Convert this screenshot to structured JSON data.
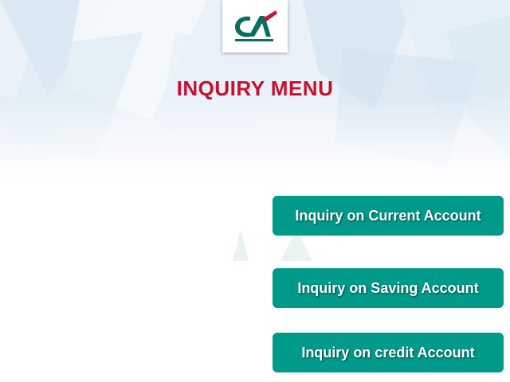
{
  "logo": {
    "icon": "credit-agricole-logo",
    "text": "CA",
    "colors": {
      "green": "#0a6e5f",
      "red": "#d0103a"
    }
  },
  "page": {
    "title": "INQUIRY MENU",
    "title_color": "#c8102e"
  },
  "menu": {
    "button_color": "#009a8a",
    "items": [
      {
        "label": "Inquiry on Current Account"
      },
      {
        "label": "Inquiry on Saving Account"
      },
      {
        "label": "Inquiry on credit Account"
      }
    ]
  }
}
